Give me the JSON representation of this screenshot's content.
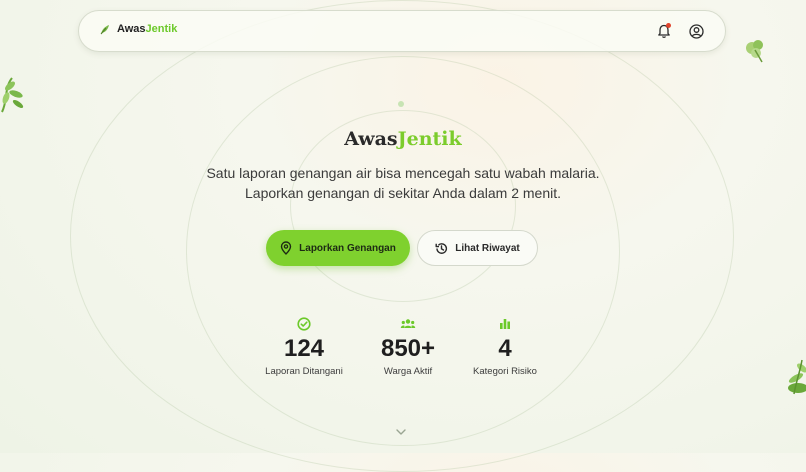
{
  "brand": {
    "name_primary": "Awas",
    "name_accent": "Jentik"
  },
  "nav": {
    "notification_icon": "bell-icon",
    "profile_icon": "user-circle-icon"
  },
  "hero": {
    "title_primary": "Awas",
    "title_accent": "Jentik",
    "subtitle_line1": "Satu laporan genangan air bisa mencegah satu wabah malaria.",
    "subtitle_line2": "Laporkan genangan di sekitar Anda dalam 2 menit."
  },
  "actions": {
    "primary_label": "Laporkan Genangan",
    "primary_icon": "map-pin-icon",
    "secondary_label": "Lihat Riwayat",
    "secondary_icon": "history-icon"
  },
  "stats": [
    {
      "value": "124",
      "label": "Laporan Ditangani",
      "icon": "check-circle-icon"
    },
    {
      "value": "850+",
      "label": "Warga Aktif",
      "icon": "users-icon"
    },
    {
      "value": "4",
      "label": "Kategori Risiko",
      "icon": "bar-chart-icon"
    }
  ],
  "colors": {
    "accent": "#7fd12e",
    "brand_accent": "#6cc92a",
    "notification": "#e0432c"
  }
}
